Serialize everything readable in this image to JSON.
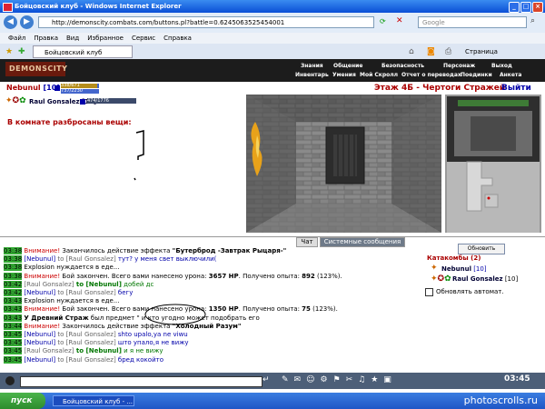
{
  "window": {
    "title": "Бойцовский клуб - Windows Internet Explorer"
  },
  "address": {
    "url": "http://demonscity.combats.com/buttons.pl?battle=0.6245063525454001",
    "search_placeholder": "Google"
  },
  "menu": [
    "Файл",
    "Правка",
    "Вид",
    "Избранное",
    "Сервис",
    "Справка"
  ],
  "tab": {
    "label": "Бойцовский клуб",
    "page_label": "Страница"
  },
  "game": {
    "logo": "DEMONSCITY",
    "top_menu": [
      "Знания",
      "Общение",
      "Безопасность",
      "Персонаж",
      "Выход"
    ],
    "sub_menu": [
      "Инвентарь",
      "Умения",
      "Мой Скролл",
      "Отчет о переводах",
      "Поединки",
      "Анкета"
    ],
    "player": {
      "name": "Nebunul",
      "level": "[10]",
      "hp": "338/671",
      "mana": "737/2230"
    },
    "opponent": {
      "name": "Raul Gonsalez",
      "level": "[10]",
      "hp": "474/1776"
    },
    "room_title": "В комнате разбросаны вещи:",
    "location": "Этаж 4Б - Чертоги Стражей",
    "exit_label": "Выйти"
  },
  "chat_tabs": {
    "chat": "Чат",
    "system": "Системные сообщения"
  },
  "chat": [
    {
      "time": "03:38",
      "kind": "alert",
      "prefix": "Внимание!",
      "text": " Закончилось действие эффекта ",
      "bold": "\"Бутерброд -Завтрак Рыцаря-\""
    },
    {
      "time": "03:38",
      "kind": "msg",
      "from": "[Nebunul]",
      "to": " to [Raul Gonsalez]",
      "text": " тут? у меня свет выключили("
    },
    {
      "time": "03:38",
      "kind": "sys",
      "text": "Explosion нуждается в еде..."
    },
    {
      "time": "03:38",
      "kind": "alert",
      "prefix": "Внимание!",
      "text": " Бой закончен. Всего вами нанесено урона: ",
      "bold": "3657 HP",
      "tail": ". Получено опыта: ",
      "bold2": "892",
      "tail2": " (123%)."
    },
    {
      "time": "03:42",
      "kind": "msg2",
      "from": "[Raul Gonsalez]",
      "to": " to [Nebunul]",
      "text": " добей дс"
    },
    {
      "time": "03:42",
      "kind": "msg",
      "from": "[Nebunul]",
      "to": " to [Raul Gonsalez]",
      "text": " бегу"
    },
    {
      "time": "03:43",
      "kind": "sys",
      "text": "Explosion нуждается в еде..."
    },
    {
      "time": "03:43",
      "kind": "alert",
      "prefix": "Внимание!",
      "text": " Бой закончен. Всего вами нанесено урона: ",
      "bold": "1350 HP",
      "tail": ". Получено опыта: ",
      "bold2": "75",
      "tail2": " (123%)."
    },
    {
      "time": "03:43",
      "kind": "plain",
      "bold": "У Древний Страж",
      "text": " был предмет \" и кто угодно может подобрать его"
    },
    {
      "time": "03:44",
      "kind": "alert",
      "prefix": "Внимание!",
      "text": " Закончилось действие эффекта ",
      "bold": "\"Холодный Разум\""
    },
    {
      "time": "03:45",
      "kind": "msg",
      "from": "[Nebunul]",
      "to": " to [Raul Gonsalez]",
      "text": " shto upalo,ya ne viwu"
    },
    {
      "time": "03:45",
      "kind": "msg",
      "from": "[Nebunul]",
      "to": " to [Raul Gonsalez]",
      "text": " што упало,я не вижу"
    },
    {
      "time": "03:45",
      "kind": "msg2",
      "from": "[Raul Gonsalez]",
      "to": " to [Nebunul]",
      "text": " и я не вижу"
    },
    {
      "time": "03:45",
      "kind": "msg",
      "from": "[Nebunul]",
      "to": " to [Raul Gonsalez]",
      "text": " бред кокойто"
    }
  ],
  "right_panel": {
    "refresh": "Обновить",
    "title": "Катакомбы (2)",
    "members": [
      {
        "name": "Nebunul",
        "level": "[10]"
      },
      {
        "name": "Raul Gonsalez",
        "level": "[10]"
      }
    ],
    "auto_label": "Обновлять автомат."
  },
  "clock": "03:45",
  "taskbar": {
    "start": "пуск",
    "item": "Бойцовский клуб - ...",
    "watermark": "photoscrolls.ru"
  }
}
